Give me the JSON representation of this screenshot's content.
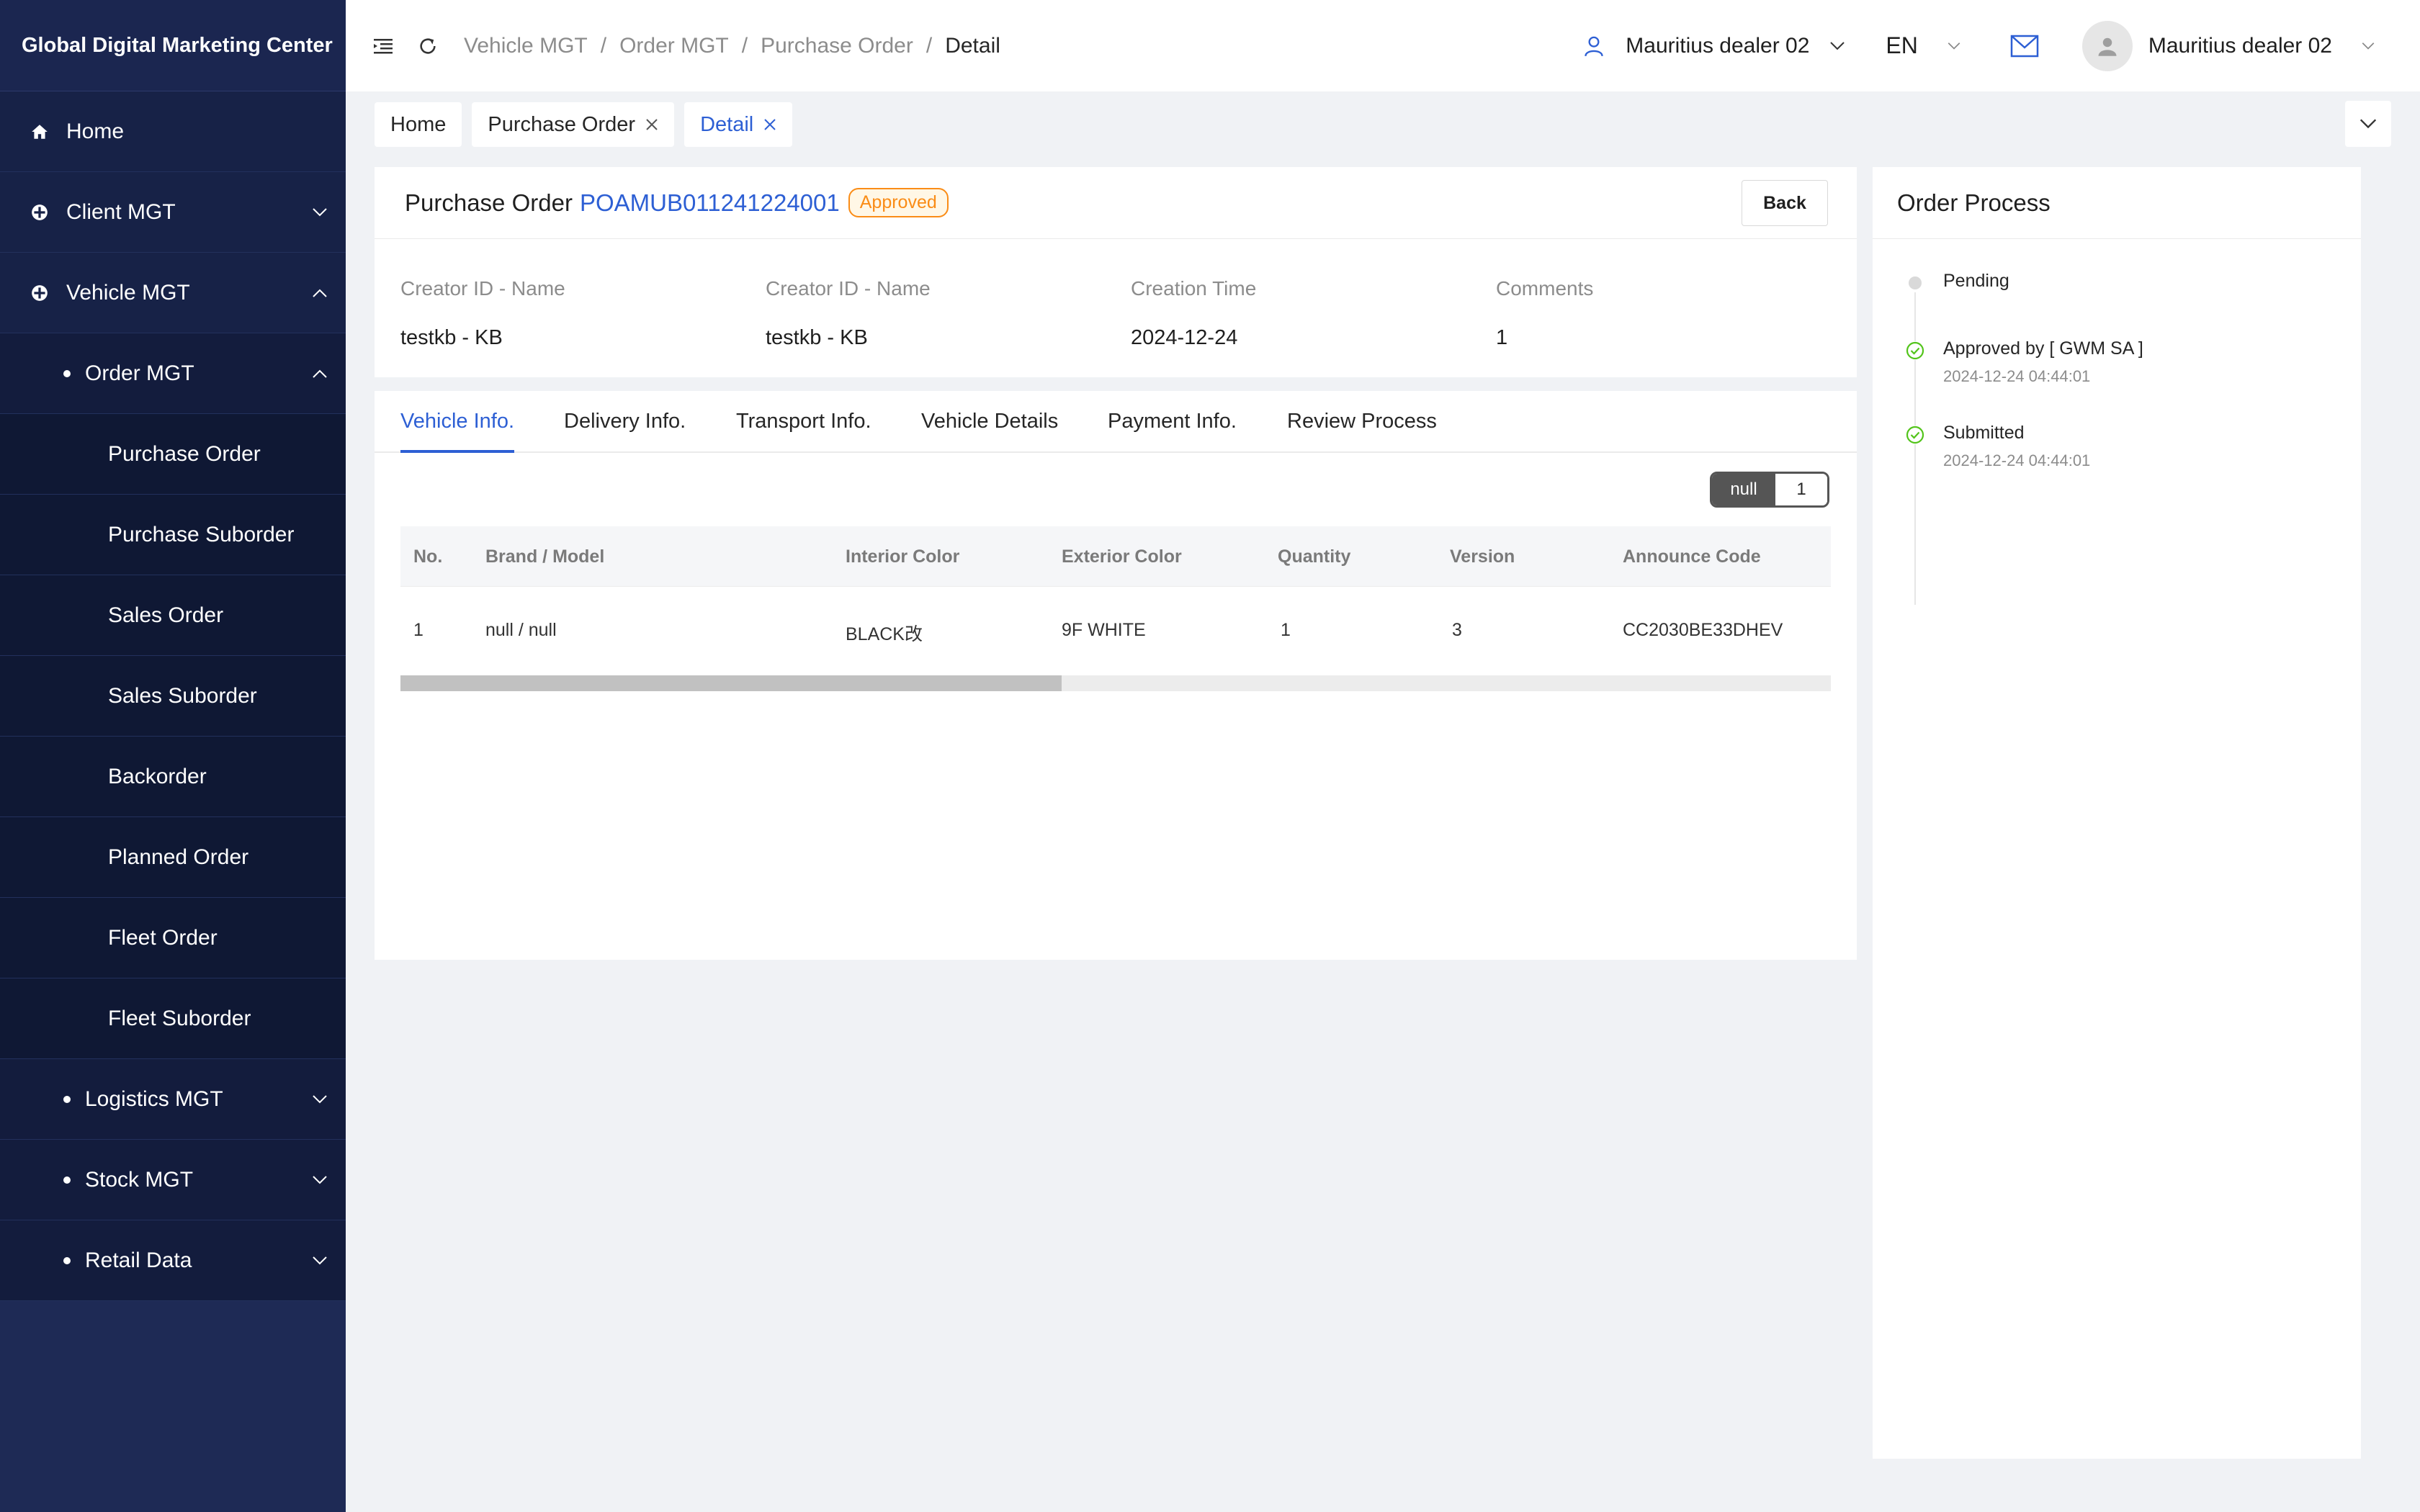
{
  "app": {
    "title": "Global Digital Marketing Center"
  },
  "sidebar": {
    "items": [
      {
        "label": "Home"
      },
      {
        "label": "Client MGT"
      },
      {
        "label": "Vehicle MGT"
      },
      {
        "label": "Order MGT"
      },
      {
        "label": "Purchase Order"
      },
      {
        "label": "Purchase Suborder"
      },
      {
        "label": "Sales Order"
      },
      {
        "label": "Sales Suborder"
      },
      {
        "label": "Backorder"
      },
      {
        "label": "Planned Order"
      },
      {
        "label": "Fleet Order"
      },
      {
        "label": "Fleet Suborder"
      },
      {
        "label": "Logistics MGT"
      },
      {
        "label": "Stock MGT"
      },
      {
        "label": "Retail Data"
      }
    ]
  },
  "header": {
    "breadcrumb": [
      "Vehicle MGT",
      "Order MGT",
      "Purchase Order",
      "Detail"
    ],
    "breadcrumb_sep": "/",
    "dealer": "Mauritius dealer 02",
    "language": "EN",
    "user": "Mauritius dealer 02"
  },
  "page_tabs": [
    {
      "label": "Home"
    },
    {
      "label": "Purchase Order"
    },
    {
      "label": "Detail"
    }
  ],
  "order": {
    "label": "Purchase Order",
    "number": "POAMUB011241224001",
    "status": "Approved",
    "back_label": "Back",
    "fields": [
      {
        "label": "Creator ID - Name",
        "value": "testkb - KB"
      },
      {
        "label": "Creator ID - Name",
        "value": "testkb - KB"
      },
      {
        "label": "Creation Time",
        "value": "2024-12-24"
      },
      {
        "label": "Comments",
        "value": "1"
      }
    ]
  },
  "detail_tabs": [
    "Vehicle Info.",
    "Delivery Info.",
    "Transport Info.",
    "Vehicle Details",
    "Payment Info.",
    "Review Process"
  ],
  "segment": {
    "left": "null",
    "right": "1"
  },
  "table": {
    "columns": [
      "No.",
      "Brand / Model",
      "Interior Color",
      "Exterior Color",
      "Quantity",
      "Version",
      "Announce Code"
    ],
    "rows": [
      [
        "1",
        "null / null",
        "BLACK改",
        "9F WHITE",
        "1",
        "3",
        "CC2030BE33DHEV"
      ]
    ]
  },
  "process": {
    "title": "Order Process",
    "steps": [
      {
        "title": "Pending",
        "time": ""
      },
      {
        "title": "Approved by [ GWM SA ]",
        "time": "2024-12-24 04:44:01"
      },
      {
        "title": "Submitted",
        "time": "2024-12-24 04:44:01"
      }
    ]
  },
  "colors": {
    "sidebar": "#1e2a55",
    "accent": "#2d5fd4",
    "warning": "#fa8c16",
    "success": "#52c41a"
  }
}
